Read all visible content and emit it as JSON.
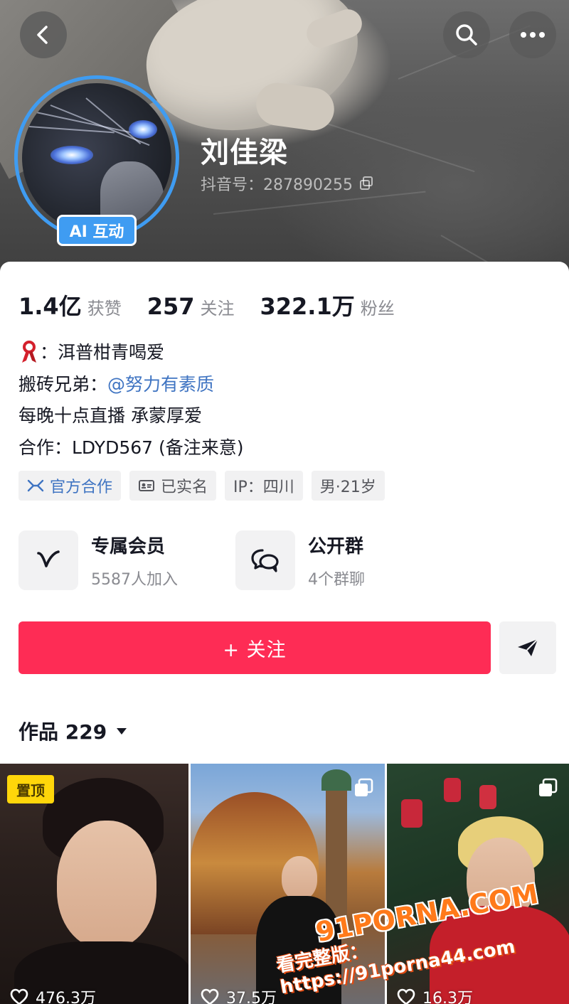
{
  "profile": {
    "username": "刘佳梁",
    "douyin_id": "抖音号：287890255",
    "ai_badge": "AI 互动"
  },
  "stats": [
    {
      "value": "1.4亿",
      "label": "获赞"
    },
    {
      "value": "257",
      "label": "关注"
    },
    {
      "value": "322.1万",
      "label": "粉丝"
    }
  ],
  "bio": {
    "line1_text": "：洱普柑青喝爱",
    "line2_prefix": "搬砖兄弟：",
    "line2_mention": "@努力有素质",
    "line3": "每晚十点直播 承蒙厚爱",
    "line4": "合作：LDYD567 (备注来意)"
  },
  "tags": [
    {
      "label": "官方合作",
      "icon": "official-cooperation-icon"
    },
    {
      "label": "已实名",
      "icon": "id-card-icon"
    },
    {
      "label": "IP：四川"
    },
    {
      "label": "男·21岁"
    }
  ],
  "entries": [
    {
      "title": "专属会员",
      "subtitle": "5587人加入",
      "icon": "v-member-icon"
    },
    {
      "title": "公开群",
      "subtitle": "4个群聊",
      "icon": "chat-bubbles-icon"
    }
  ],
  "actions": {
    "follow_label": "+ 关注"
  },
  "works": {
    "label": "作品 229"
  },
  "videos": [
    {
      "likes": "476.3万",
      "pinned_label": "置顶"
    },
    {
      "likes": "37.5万"
    },
    {
      "likes": "16.3万"
    }
  ],
  "watermark": {
    "line1": "91PORNA.COM",
    "line2": "看完整版：https://91porna44.com"
  },
  "colors": {
    "accent": "#fe2c55",
    "ring_blue": "#3f9cf2",
    "mention_blue": "#3f74c2",
    "pin_yellow": "#ffd60a"
  }
}
